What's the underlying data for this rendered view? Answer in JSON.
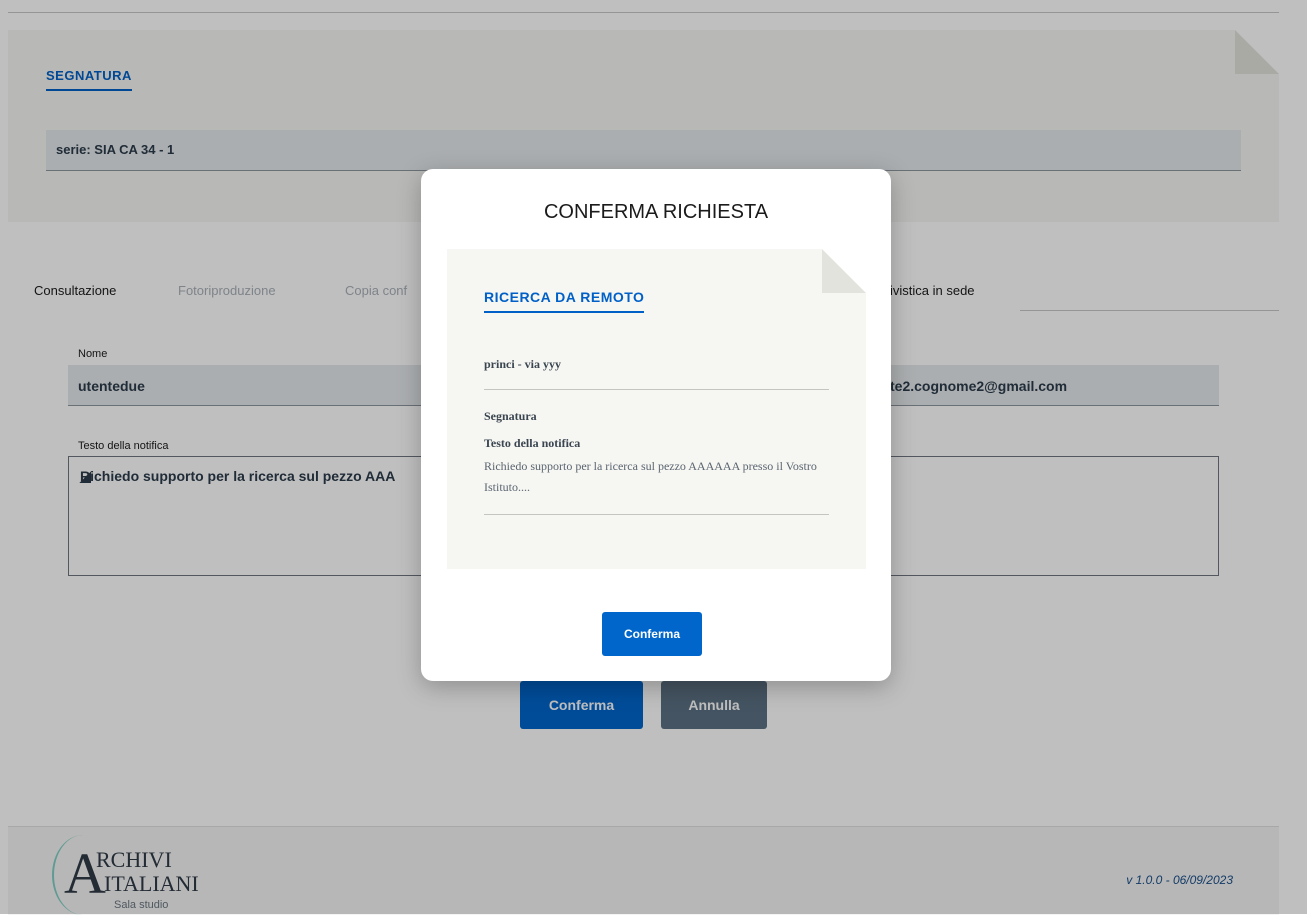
{
  "segnatura": {
    "title": "SEGNATURA",
    "serie": "serie: SIA CA 34 - 1"
  },
  "tabs": [
    {
      "label": "Consultazione",
      "active": true
    },
    {
      "label": "Fotoriproduzione",
      "active": false
    },
    {
      "label": "Copia conf",
      "active": false
    },
    {
      "label": "ivistica in sede",
      "active": true
    }
  ],
  "form": {
    "nome_label": "Nome",
    "nome_value": "utentedue",
    "email_value": "te2.cognome2@gmail.com",
    "testo_label": "Testo della notifica",
    "testo_value": "Richiedo supporto per la ricerca sul pezzo AAA"
  },
  "buttons": {
    "conferma": "Conferma",
    "annulla": "Annulla"
  },
  "footer": {
    "logo_a": "A",
    "logo_line1": "RCHIVI",
    "logo_line2": "ITALIANI",
    "logo_sub": "Sala studio",
    "version": "v 1.0.0 - 06/09/2023"
  },
  "modal": {
    "title": "CONFERMA RICHIESTA",
    "card_title": "RICERCA DA REMOTO",
    "user": "princi - via yyy",
    "segnatura_label": "Segnatura",
    "testo_label": "Testo della notifica",
    "testo_value": "Richiedo supporto per la ricerca sul pezzo AAAAAA presso il Vostro Istituto....",
    "confirm_label": "Conferma"
  },
  "colors": {
    "primary": "#0066cc",
    "secondary": "#5d7083",
    "card_bg": "#f6f6f2"
  }
}
